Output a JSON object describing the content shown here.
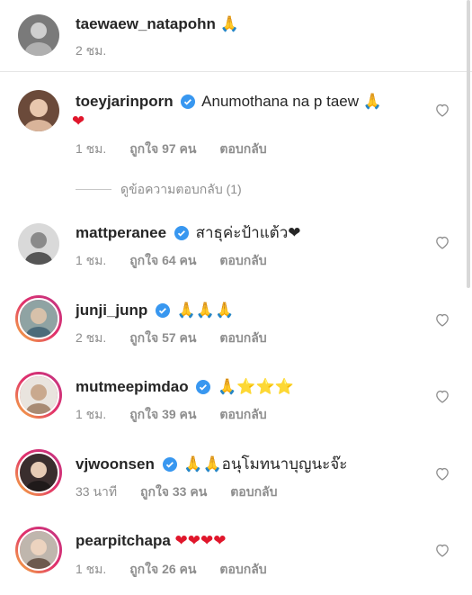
{
  "caption": {
    "username": "taewaew_natapohn",
    "emoji": "🙏",
    "time": "2 ชม."
  },
  "view_replies": "ดูข้อความตอบกลับ (1)",
  "comments": [
    {
      "username": "toeyjarinporn",
      "text": "Anumothana na p taew 🙏",
      "text2": "❤",
      "time": "1 ชม.",
      "likes": "ถูกใจ 97 คน",
      "reply": "ตอบกลับ"
    },
    {
      "username": "mattperanee",
      "text": "สาธุค่ะป้าแต้ว❤",
      "time": "1 ชม.",
      "likes": "ถูกใจ 64 คน",
      "reply": "ตอบกลับ"
    },
    {
      "username": "junji_junp",
      "text": "🙏🙏🙏",
      "time": "2 ชม.",
      "likes": "ถูกใจ 57 คน",
      "reply": "ตอบกลับ"
    },
    {
      "username": "mutmeepimdao",
      "text": "🙏⭐⭐⭐",
      "time": "1 ชม.",
      "likes": "ถูกใจ 39 คน",
      "reply": "ตอบกลับ"
    },
    {
      "username": "vjwoonsen",
      "text": "🙏🙏อนุโมทนาบุญนะจ๊ะ",
      "time": "33 นาที",
      "likes": "ถูกใจ 33 คน",
      "reply": "ตอบกลับ"
    },
    {
      "username": "pearpitchapa",
      "text": "❤❤❤❤",
      "time": "1 ชม.",
      "likes": "ถูกใจ 26 คน",
      "reply": "ตอบกลับ"
    }
  ],
  "icons": {
    "verified": "verified-badge-icon",
    "like": "heart-outline-icon"
  },
  "colors": {
    "verified": "#3897f0",
    "muted": "#8e8e8e",
    "text": "#262626"
  }
}
